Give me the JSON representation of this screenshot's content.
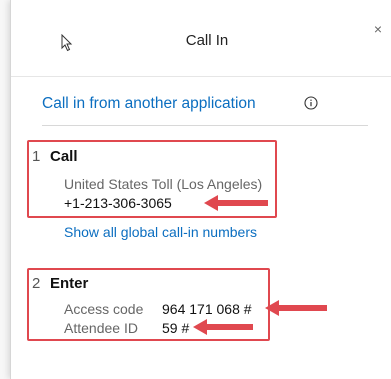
{
  "dialog": {
    "title": "Call In",
    "close_glyph": "×"
  },
  "heading": {
    "text": "Call in from another application",
    "info_icon": "info-circle-icon"
  },
  "step1": {
    "number": "1",
    "label": "Call",
    "location": "United States Toll (Los Angeles)",
    "phone": "+1-213-306-3065",
    "link": "Show all global call-in numbers"
  },
  "step2": {
    "number": "2",
    "label": "Enter",
    "access_label": "Access code",
    "access_value": "964 171 068 #",
    "attendee_label": "Attendee ID",
    "attendee_value": "59 #"
  },
  "colors": {
    "accent": "#0b6ec0",
    "highlight": "#e0484f"
  }
}
